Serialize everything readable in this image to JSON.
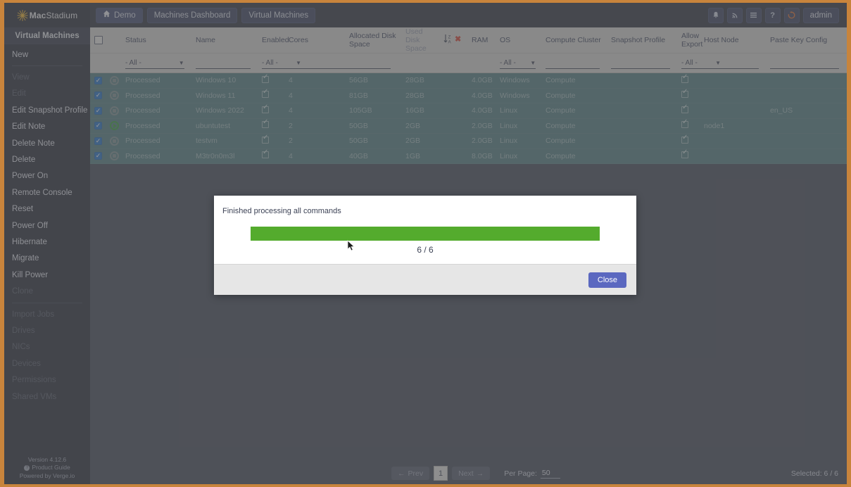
{
  "brand": {
    "mac": "Mac",
    "stadium": "Stadium",
    "burst_icon": "sunburst-icon"
  },
  "topnav": {
    "buttons": [
      {
        "label": "Demo",
        "icon": "home-icon"
      },
      {
        "label": "Machines Dashboard",
        "icon": ""
      },
      {
        "label": "Virtual Machines",
        "icon": ""
      }
    ],
    "right_icons": [
      {
        "name": "bell-icon",
        "glyph": "🔔"
      },
      {
        "name": "rss-icon",
        "glyph": "◔"
      },
      {
        "name": "menu-icon",
        "glyph": "≡"
      },
      {
        "name": "help-icon",
        "glyph": "?"
      },
      {
        "name": "refresh-icon",
        "glyph": "⟳"
      }
    ],
    "user": "admin",
    "refresh_color": "#e06a28"
  },
  "sidebar": {
    "title": "Virtual Machines",
    "items": [
      {
        "label": "New",
        "disabled": false
      },
      {
        "label": "View",
        "disabled": true
      },
      {
        "label": "Edit",
        "disabled": true
      },
      {
        "label": "Edit Snapshot Profile",
        "disabled": false
      },
      {
        "label": "Edit Note",
        "disabled": false
      },
      {
        "label": "Delete Note",
        "disabled": false
      },
      {
        "label": "Delete",
        "disabled": false
      },
      {
        "label": "Power On",
        "disabled": false
      },
      {
        "label": "Remote Console",
        "disabled": false
      },
      {
        "label": "Reset",
        "disabled": false
      },
      {
        "label": "Power Off",
        "disabled": false
      },
      {
        "label": "Hibernate",
        "disabled": false
      },
      {
        "label": "Migrate",
        "disabled": false
      },
      {
        "label": "Kill Power",
        "disabled": false
      },
      {
        "label": "Clone",
        "disabled": true
      },
      {
        "label": "Import Jobs",
        "disabled": true
      },
      {
        "label": "Drives",
        "disabled": true
      },
      {
        "label": "NICs",
        "disabled": true
      },
      {
        "label": "Devices",
        "disabled": true
      },
      {
        "label": "Permissions",
        "disabled": true
      },
      {
        "label": "Shared VMs",
        "disabled": true
      }
    ],
    "footer": {
      "version": "Version 4.12.6",
      "product_guide": "Product Guide",
      "powered_by": "Powered by Verge.io"
    }
  },
  "table": {
    "columns": [
      "Status",
      "Name",
      "Enabled",
      "Cores",
      "Allocated Disk Space",
      "Used Disk Space",
      "RAM",
      "OS",
      "Compute Cluster",
      "Snapshot Profile",
      "Allow Export",
      "Host Node",
      "Paste Key Config"
    ],
    "sort": {
      "icon": "sort-za-icon",
      "clear": "✖"
    },
    "filters": {
      "status": "- All -",
      "name": "",
      "enabled": "- All -",
      "cores": "",
      "os": "- All -",
      "compute_cluster": "",
      "snapshot_profile": "",
      "allow_export": "- All -",
      "host_node": "",
      "paste_key_config": ""
    },
    "rows": [
      {
        "selected": true,
        "state": "stopped",
        "status": "Processed",
        "name": "Windows 10",
        "enabled": true,
        "cores": "4",
        "alloc": "56GB",
        "used": "28GB",
        "ram": "4.0GB",
        "os": "Windows",
        "cluster": "Compute",
        "snapshot": "",
        "allow_export": true,
        "host_node": "",
        "paste_key": ""
      },
      {
        "selected": true,
        "state": "stopped",
        "status": "Processed",
        "name": "Windows 11",
        "enabled": true,
        "cores": "4",
        "alloc": "81GB",
        "used": "28GB",
        "ram": "4.0GB",
        "os": "Windows",
        "cluster": "Compute",
        "snapshot": "",
        "allow_export": true,
        "host_node": "",
        "paste_key": ""
      },
      {
        "selected": true,
        "state": "stopped",
        "status": "Processed",
        "name": "Windows 2022",
        "enabled": true,
        "cores": "4",
        "alloc": "105GB",
        "used": "16GB",
        "ram": "4.0GB",
        "os": "Linux",
        "cluster": "Compute",
        "snapshot": "",
        "allow_export": true,
        "host_node": "",
        "paste_key": "en_US"
      },
      {
        "selected": true,
        "state": "running",
        "status": "Processed",
        "name": "ubuntutest",
        "enabled": true,
        "cores": "2",
        "alloc": "50GB",
        "used": "2GB",
        "ram": "2.0GB",
        "os": "Linux",
        "cluster": "Compute",
        "snapshot": "",
        "allow_export": true,
        "host_node": "node1",
        "paste_key": ""
      },
      {
        "selected": true,
        "state": "stopped",
        "status": "Processed",
        "name": "testvm",
        "enabled": true,
        "cores": "2",
        "alloc": "50GB",
        "used": "2GB",
        "ram": "2.0GB",
        "os": "Linux",
        "cluster": "Compute",
        "snapshot": "",
        "allow_export": true,
        "host_node": "",
        "paste_key": ""
      },
      {
        "selected": true,
        "state": "stopped",
        "status": "Processed",
        "name": "M3tr0n0m3l",
        "enabled": true,
        "cores": "4",
        "alloc": "40GB",
        "used": "1GB",
        "ram": "8.0GB",
        "os": "Linux",
        "cluster": "Compute",
        "snapshot": "",
        "allow_export": true,
        "host_node": "",
        "paste_key": ""
      }
    ]
  },
  "footer": {
    "prev": "Prev",
    "page": "1",
    "next": "Next",
    "per_page_label": "Per Page:",
    "per_page_value": "50",
    "selected": "Selected: 6 / 6"
  },
  "modal": {
    "message": "Finished processing all commands",
    "progress_percent": 100,
    "progress_label": "6 / 6",
    "close_label": "Close",
    "bar_color": "#54ab2d"
  }
}
